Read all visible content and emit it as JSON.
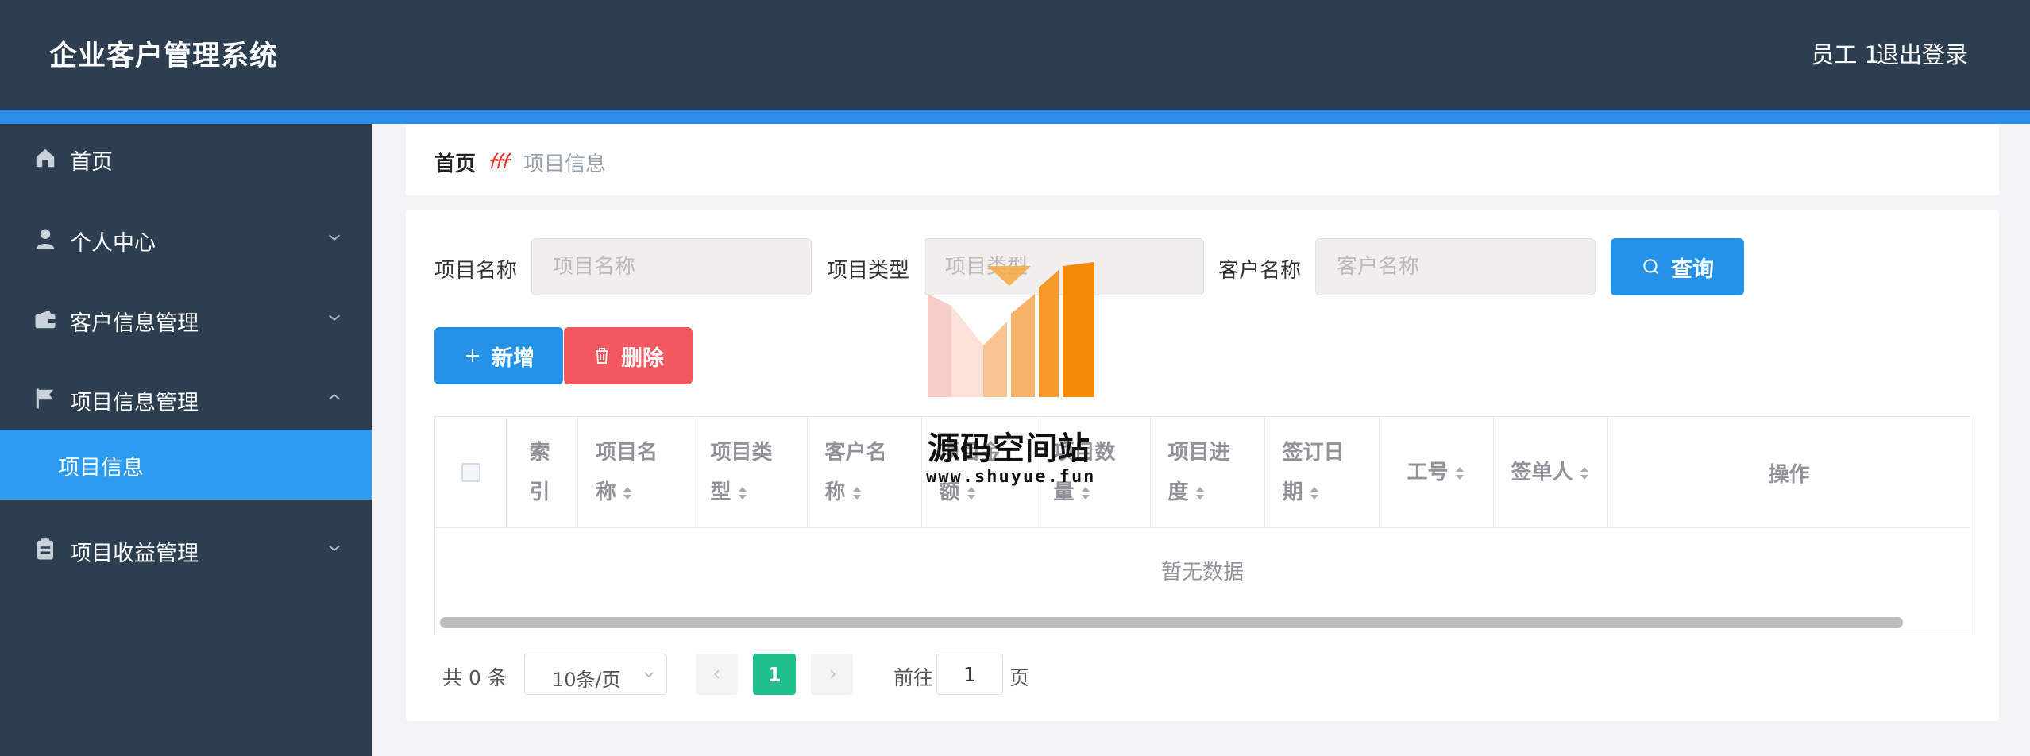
{
  "header": {
    "title": "企业客户管理系统",
    "user": "员工 1",
    "logout": "退出登录"
  },
  "sidebar": {
    "items": [
      {
        "label": "首页",
        "icon": "home-icon"
      },
      {
        "label": "个人中心",
        "icon": "user-icon"
      },
      {
        "label": "客户信息管理",
        "icon": "wallet-icon"
      },
      {
        "label": "项目信息管理",
        "icon": "flag-icon"
      },
      {
        "label": "项目收益管理",
        "icon": "clipboard-icon"
      }
    ],
    "active_sub": "项目信息"
  },
  "breadcrumb": {
    "home": "首页",
    "current": "项目信息"
  },
  "search": {
    "fields": [
      {
        "label": "项目名称",
        "placeholder": "项目名称"
      },
      {
        "label": "项目类型",
        "placeholder": "项目类型"
      },
      {
        "label": "客户名称",
        "placeholder": "客户名称"
      }
    ],
    "query_label": "查询"
  },
  "actions": {
    "add_label": "新增",
    "delete_label": "删除"
  },
  "table": {
    "columns": [
      "索引",
      "项目名称",
      "项目类型",
      "客户名称",
      "项目金额",
      "项目数量",
      "项目进度",
      "签订日期",
      "工号",
      "签单人",
      "操作"
    ],
    "empty_text": "暂无数据"
  },
  "pagination": {
    "total_text": "共 0 条",
    "page_size": "10条/页",
    "current_page": "1",
    "goto_label": "前往",
    "goto_value": "1",
    "page_suffix": "页"
  },
  "watermark": {
    "text": "源码空间站",
    "url": "www.shuyue.fun"
  },
  "colors": {
    "header_bg": "#2c3e50",
    "accent": "#2d8ce8",
    "active_menu": "#2d9bf0",
    "primary_button": "#2492e8",
    "danger_button": "#f2585f",
    "page_active": "#1fc08e"
  }
}
